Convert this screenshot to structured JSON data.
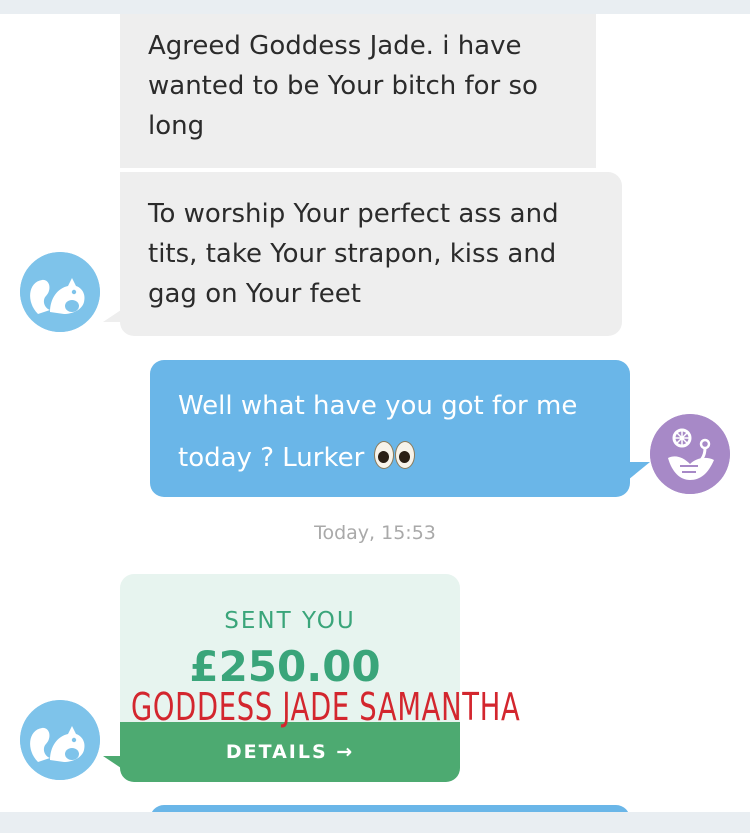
{
  "messages": [
    {
      "direction": "incoming",
      "text": "Agreed Goddess Jade. i have wanted to be Your bitch for so long"
    },
    {
      "direction": "incoming",
      "text": "To worship Your perfect ass and tits, take Your strapon, kiss and gag on Your feet"
    },
    {
      "direction": "outgoing",
      "text": "Well what have you got for me today ? Lurker"
    }
  ],
  "outgoing_emoji": "eyes-emoji",
  "timestamp": "Today, 15:53",
  "payment": {
    "label": "SENT YOU",
    "amount": "£250.00",
    "details_label": "DETAILS →"
  },
  "watermark": "GODDESS JADE SAMANTHA",
  "avatars": {
    "sender_icon": "squirrel-icon",
    "me_icon": "plant-icon"
  },
  "colors": {
    "incoming_bubble": "#eeeeee",
    "outgoing_bubble": "#6ab6e8",
    "payment_card": "#e7f4ef",
    "payment_accent": "#3aa57a",
    "details_button": "#4daa71",
    "watermark": "#d3262e",
    "sender_avatar": "#7ec3ea",
    "me_avatar": "#a789c7"
  }
}
